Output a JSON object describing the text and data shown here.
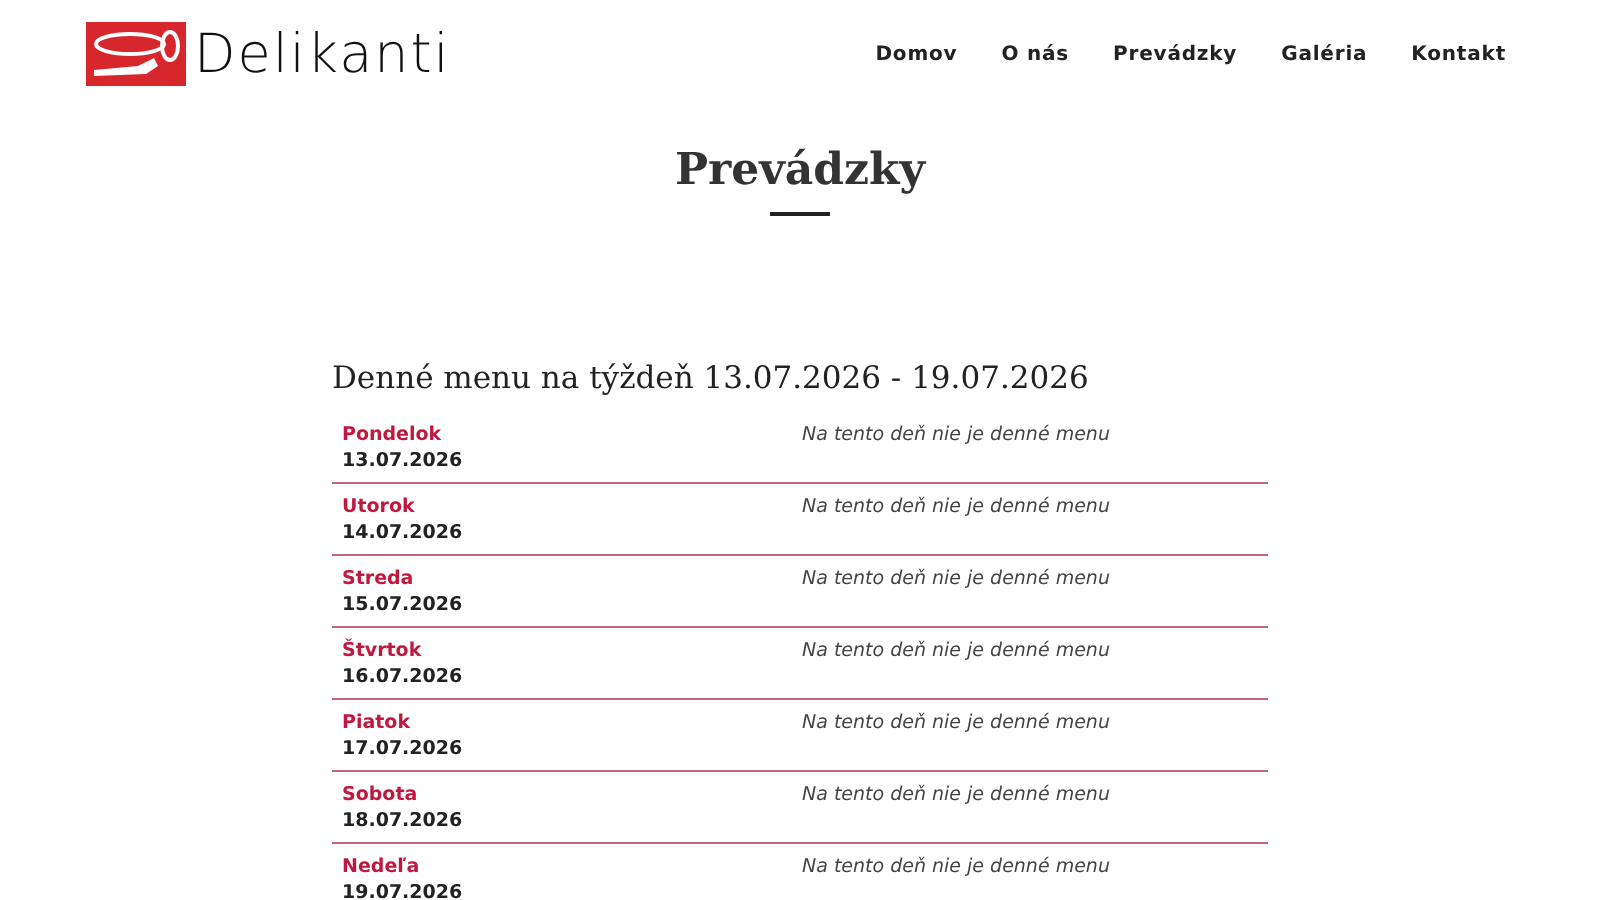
{
  "header": {
    "logo_text": "Delikanti",
    "nav": [
      "Domov",
      "O nás",
      "Prevádzky",
      "Galéria",
      "Kontakt"
    ]
  },
  "page_title": "Prevádzky",
  "menu": {
    "heading": "Denné menu na týždeň 13.07.2026 - 19.07.2026",
    "days": [
      {
        "day": "Pondelok",
        "date": "13.07.2026",
        "note": "Na tento deň nie je denné menu"
      },
      {
        "day": "Utorok",
        "date": "14.07.2026",
        "note": "Na tento deň nie je denné menu"
      },
      {
        "day": "Streda",
        "date": "15.07.2026",
        "note": "Na tento deň nie je denné menu"
      },
      {
        "day": "Štvrtok",
        "date": "16.07.2026",
        "note": "Na tento deň nie je denné menu"
      },
      {
        "day": "Piatok",
        "date": "17.07.2026",
        "note": "Na tento deň nie je denné menu"
      },
      {
        "day": "Sobota",
        "date": "18.07.2026",
        "note": "Na tento deň nie je denné menu"
      },
      {
        "day": "Nedeľa",
        "date": "19.07.2026",
        "note": "Na tento deň nie je denné menu"
      }
    ]
  }
}
